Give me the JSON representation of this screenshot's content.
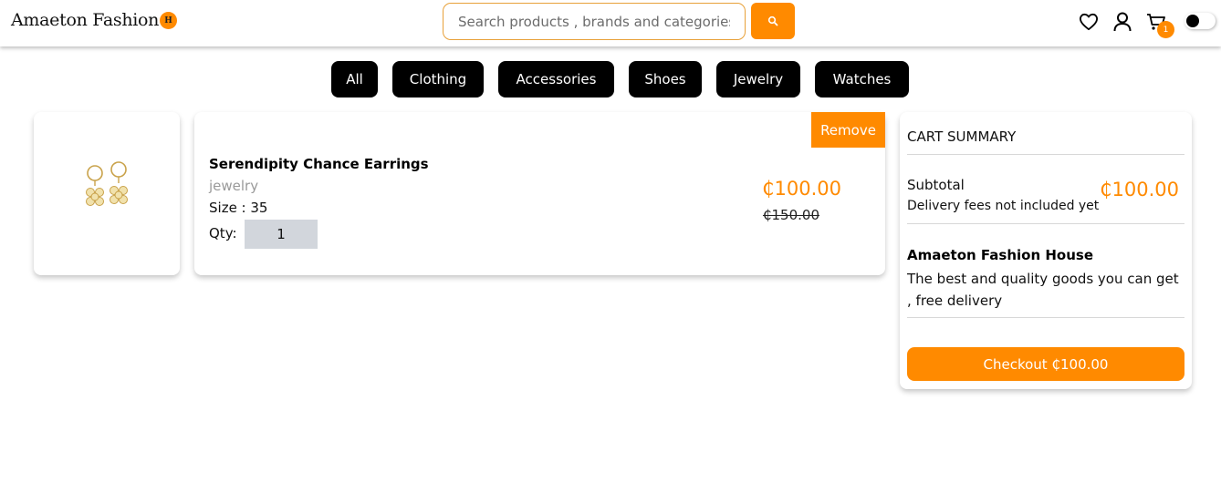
{
  "header": {
    "logo": "Amaeton Fashion",
    "logo_badge": "H",
    "search_placeholder": "Search products , brands and categories",
    "cart_count": "1",
    "icons": [
      "heart-icon",
      "user-icon",
      "cart-icon",
      "search-icon"
    ]
  },
  "categories": [
    "All",
    "Clothing",
    "Accessories",
    "Shoes",
    "Jewelry",
    "Watches"
  ],
  "cart_item": {
    "name": "Serendipity Chance Earrings",
    "category": "jewelry",
    "size": "Size : 35",
    "qty_label": "Qty:",
    "qty_value": "1",
    "price": "₵100.00",
    "old_price": "₵150.00",
    "remove_label": "Remove"
  },
  "summary": {
    "title": "CART SUMMARY",
    "subtotal_label": "Subtotal",
    "delivery_note": "Delivery fees not included yet",
    "subtotal_value": "₵100.00",
    "house_name": "Amaeton Fashion House",
    "house_desc": "The best and quality goods you can get , free delivery",
    "checkout_label": "Checkout ₵100.00"
  },
  "colors": {
    "accent": "#ff8a00",
    "category_bg": "#000000",
    "qty_bg": "#d2d6dc"
  }
}
